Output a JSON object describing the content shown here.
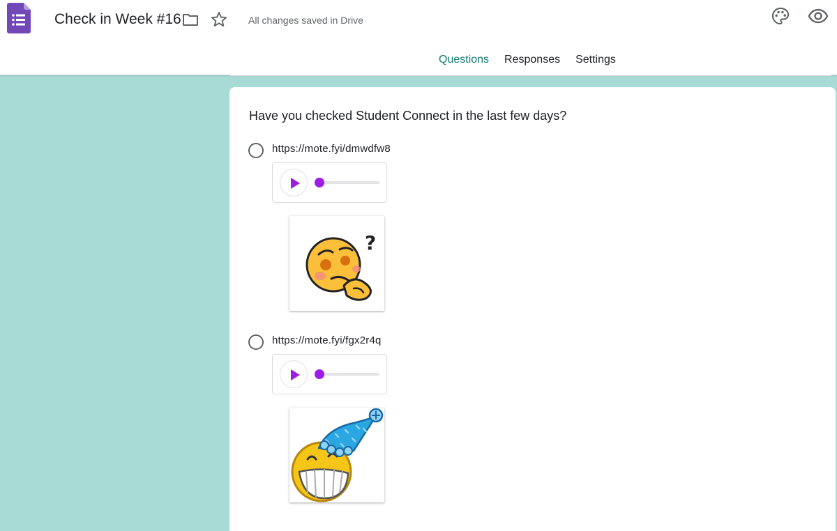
{
  "header": {
    "title": "Check in Week #16",
    "save_status": "All changes saved in Drive",
    "icons": [
      "forms-app-icon",
      "folder-icon",
      "star-icon",
      "palette-icon",
      "preview-eye-icon"
    ]
  },
  "tabs": [
    {
      "label": "Questions",
      "active": true
    },
    {
      "label": "Responses",
      "active": false
    },
    {
      "label": "Settings",
      "active": false
    }
  ],
  "colors": {
    "accent": "#137c74",
    "background": "#a8dad6",
    "app_icon": "#7248b9",
    "player_accent": "#9c1de6"
  },
  "question": {
    "text": "Have you checked Student Connect in the last few days?",
    "options": [
      {
        "label": "https://mote.fyi/dmwdfw8",
        "sticker": "thinking-face-emoji"
      },
      {
        "label": "https://mote.fyi/fgx2r4q",
        "sticker": "party-hat-grinning-emoji"
      }
    ]
  }
}
